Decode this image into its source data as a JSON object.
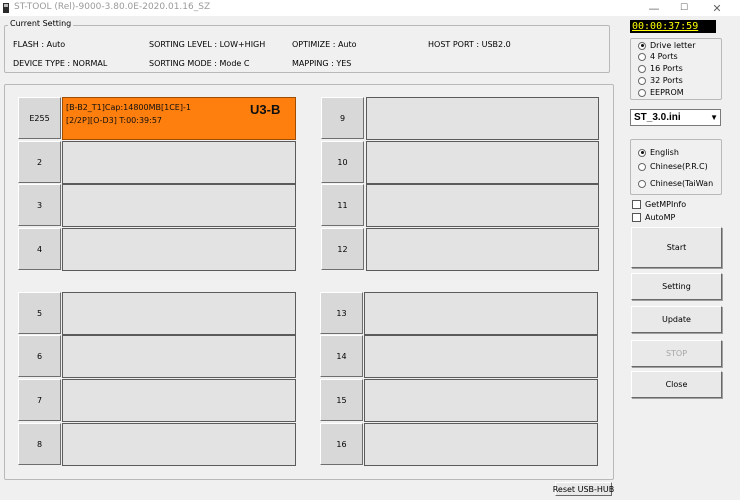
{
  "window": {
    "title": "ST-TOOL (Rel)-9000-3.80.0E-2020.01.16_SZ",
    "icon": "app-icon",
    "controls": {
      "minimize": "—",
      "maximize": "☐",
      "close": "✕"
    }
  },
  "current_setting": {
    "label": "Current Setting",
    "flash": "FLASH : Auto",
    "sorting_level": "SORTING LEVEL : LOW+HIGH",
    "optimize": "OPTIMIZE : Auto",
    "host_port": "HOST PORT : USB2.0",
    "device_type": "DEVICE TYPE : NORMAL",
    "sorting_mode": "SORTING MODE : Mode C",
    "mapping": "MAPPING : YES"
  },
  "ports": [
    {
      "label": "E255",
      "active": true,
      "line1": "[B-B2_T1]Cap:14800MB[1CE]-1",
      "line2": "[2/2P][O-D3] T:00:39:57",
      "badge": "U3-B"
    },
    {
      "label": "2"
    },
    {
      "label": "3"
    },
    {
      "label": "4"
    },
    {
      "label": "5"
    },
    {
      "label": "6"
    },
    {
      "label": "7"
    },
    {
      "label": "8"
    },
    {
      "label": "9"
    },
    {
      "label": "10"
    },
    {
      "label": "11"
    },
    {
      "label": "12"
    },
    {
      "label": "13"
    },
    {
      "label": "14"
    },
    {
      "label": "15"
    },
    {
      "label": "16"
    }
  ],
  "right_panel": {
    "timer": "00:00:37:59",
    "port_mode": {
      "options": [
        "Drive letter",
        "4 Ports",
        "16 Ports",
        "32 Ports",
        "EEPROM"
      ],
      "selected": "Drive letter"
    },
    "ini_file": "ST_3.0.ini",
    "language": {
      "options": [
        "English",
        "Chinese(P.R.C)",
        "Chinese(TaiWan"
      ],
      "selected": "English"
    },
    "checkboxes": [
      "GetMPInfo",
      "AutoMP"
    ],
    "buttons": {
      "start": "Start",
      "setting": "Setting",
      "update": "Update",
      "stop": "STOP",
      "close": "Close"
    }
  },
  "reset_usb_hub": "Reset USB-HUB",
  "colors": {
    "active_port": "#ff7f0e",
    "timer_text": "#ffff00",
    "timer_bg": "#000000"
  }
}
